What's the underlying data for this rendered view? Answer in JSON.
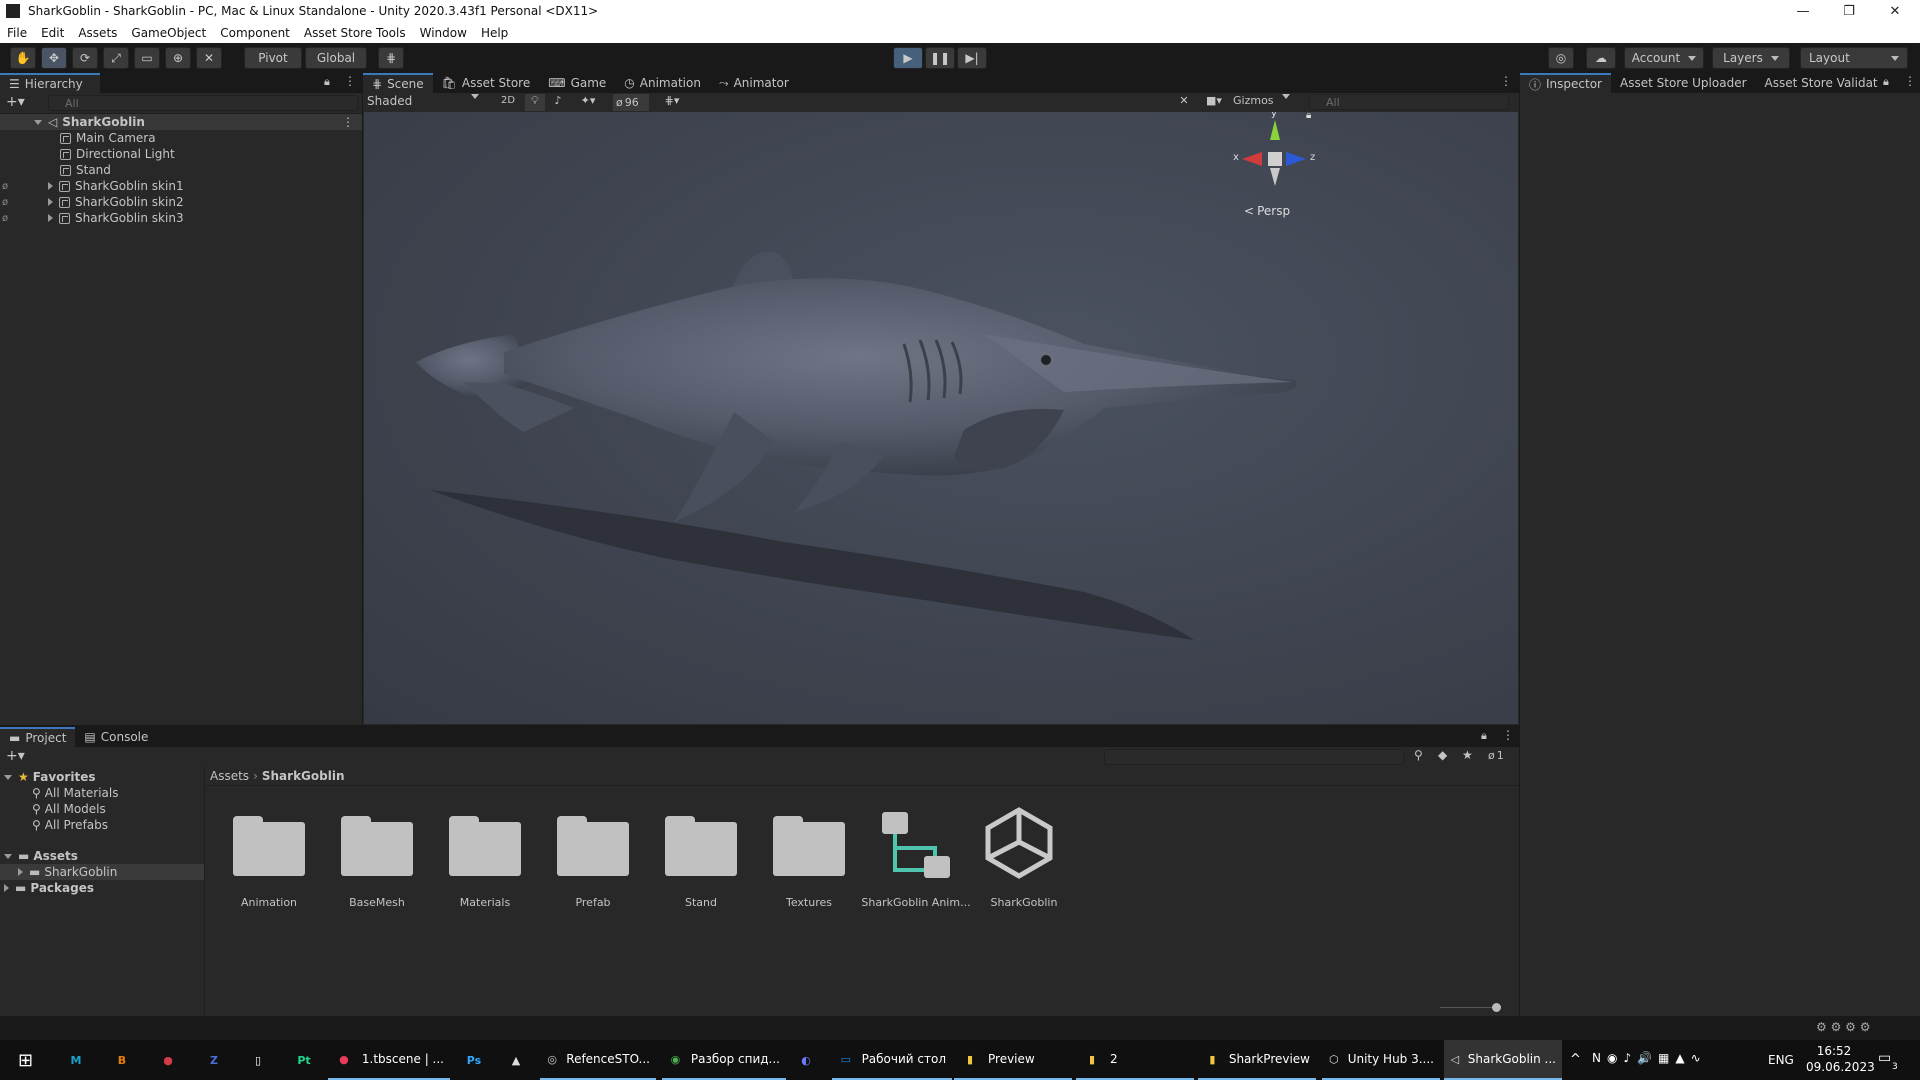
{
  "window": {
    "title": "SharkGoblin - SharkGoblin - PC, Mac & Linux Standalone - Unity 2020.3.43f1 Personal <DX11>"
  },
  "menu": [
    "File",
    "Edit",
    "Assets",
    "GameObject",
    "Component",
    "Asset Store Tools",
    "Window",
    "Help"
  ],
  "toolbar": {
    "pivot": "Pivot",
    "global": "Global",
    "account": "Account",
    "layers": "Layers",
    "layout": "Layout"
  },
  "hierarchy": {
    "tab": "Hierarchy",
    "search_placeholder": "All",
    "scene": "SharkGoblin",
    "items": [
      "Main Camera",
      "Directional Light",
      "Stand",
      "SharkGoblin skin1",
      "SharkGoblin skin2",
      "SharkGoblin skin3"
    ]
  },
  "scene": {
    "tabs": [
      "Scene",
      "Asset Store",
      "Game",
      "Animation",
      "Animator"
    ],
    "shading": "Shaded",
    "mode_2d": "2D",
    "hidden_count": "96",
    "gizmos": "Gizmos",
    "search_placeholder": "All",
    "persp": "Persp",
    "axis": {
      "x": "x",
      "y": "y",
      "z": "z"
    }
  },
  "inspector": {
    "tabs": [
      "Inspector",
      "Asset Store Uploader",
      "Asset Store Validat"
    ]
  },
  "project": {
    "tabs": [
      "Project",
      "Console"
    ],
    "favorites_label": "Favorites",
    "favorites": [
      "All Materials",
      "All Models",
      "All Prefabs"
    ],
    "assets_label": "Assets",
    "assets_child": "SharkGoblin",
    "packages_label": "Packages",
    "breadcrumb": [
      "Assets",
      "SharkGoblin"
    ],
    "hidden_count": "1",
    "items": [
      "Animation",
      "BaseMesh",
      "Materials",
      "Prefab",
      "Stand",
      "Textures",
      "SharkGoblin Anim...",
      "SharkGoblin"
    ]
  },
  "taskbar": {
    "apps": [
      {
        "label": "",
        "icon": "M",
        "color": "#1da1c9"
      },
      {
        "label": "",
        "icon": "B",
        "color": "#e87d0d"
      },
      {
        "label": "",
        "icon": "●",
        "color": "#d63b4a"
      },
      {
        "label": "",
        "icon": "Z",
        "color": "#4c6fd6"
      },
      {
        "label": "",
        "icon": "▯",
        "color": "#ffffff"
      },
      {
        "label": "",
        "icon": "Pt",
        "color": "#1fd78a"
      },
      {
        "label": "1.tbscene | ...",
        "icon": "●",
        "color": "#e83a5a"
      },
      {
        "label": "",
        "icon": "Ps",
        "color": "#31a8ff"
      },
      {
        "label": "",
        "icon": "▲",
        "color": "#dddddd"
      },
      {
        "label": "RefenceSTO...",
        "icon": "◎",
        "color": "#cccccc"
      },
      {
        "label": "Разбор спид...",
        "icon": "◉",
        "color": "#4caf50"
      },
      {
        "label": "",
        "icon": "◐",
        "color": "#6a7cff"
      },
      {
        "label": "Рабочий стол",
        "icon": "▭",
        "color": "#1e88e5"
      },
      {
        "label": "Preview",
        "icon": "▮",
        "color": "#f4c542"
      },
      {
        "label": "2",
        "icon": "▮",
        "color": "#f4c542"
      },
      {
        "label": "SharkPreview",
        "icon": "▮",
        "color": "#f4c542"
      },
      {
        "label": "Unity Hub 3....",
        "icon": "⬡",
        "color": "#dddddd"
      },
      {
        "label": "SharkGoblin ...",
        "icon": "◁",
        "color": "#dddddd"
      }
    ],
    "lang": "ENG",
    "time": "16:52",
    "date": "09.06.2023",
    "notifications": "3"
  }
}
